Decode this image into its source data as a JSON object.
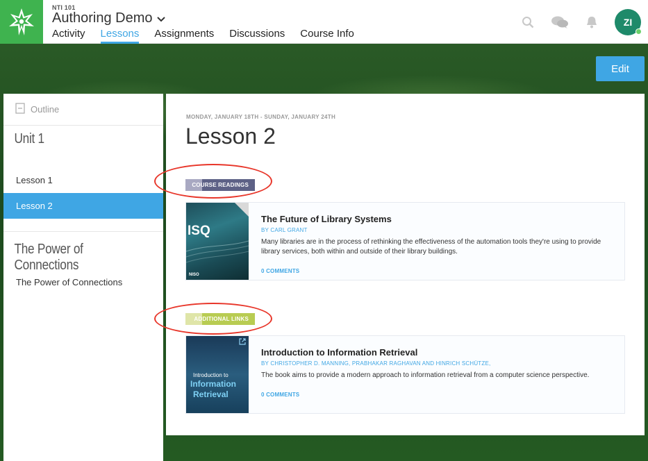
{
  "header": {
    "course_code": "NTI 101",
    "course_title": "Authoring Demo",
    "tabs": [
      {
        "label": "Activity",
        "active": false
      },
      {
        "label": "Lessons",
        "active": true
      },
      {
        "label": "Assignments",
        "active": false
      },
      {
        "label": "Discussions",
        "active": false
      },
      {
        "label": "Course Info",
        "active": false
      }
    ],
    "avatar_initials": "ZI"
  },
  "toolbar": {
    "edit_label": "Edit"
  },
  "sidebar": {
    "outline_label": "Outline",
    "units": [
      {
        "title": "Unit 1",
        "lessons": [
          {
            "label": "Lesson 1",
            "active": false
          },
          {
            "label": "Lesson 2",
            "active": true
          }
        ]
      },
      {
        "title": "The Power of Connections",
        "lessons": [
          {
            "label": "The Power of Connections",
            "active": false
          }
        ]
      }
    ]
  },
  "lesson": {
    "date_range": "MONDAY, JANUARY 18TH - SUNDAY, JANUARY 24TH",
    "title": "Lesson 2",
    "sections": [
      {
        "label": "COURSE READINGS",
        "item": {
          "title": "The Future of Library Systems",
          "author": "BY CARL GRANT",
          "description": "Many libraries are in the process of rethinking the effectiveness of the automation tools they're using to provide library services, both within and outside of their library buildings.",
          "comments": "0 COMMENTS",
          "thumb_text": "ISQ",
          "thumb_footer": "NISO"
        }
      },
      {
        "label": "ADDITIONAL LINKS",
        "item": {
          "title": "Introduction to Information Retrieval",
          "author": "BY CHRISTOPHER D. MANNING, PRABHAKAR RAGHAVAN AND HINRICH SCHÜTZE,",
          "description": "The book aims to provide a modern approach to information retrieval from a computer science perspective.",
          "comments": "0 COMMENTS",
          "thumb_line1": "Introduction to",
          "thumb_line2": "Information",
          "thumb_line3": "Retrieval"
        }
      }
    ]
  },
  "colors": {
    "accent": "#3fa6e4",
    "brand_green": "#3fb34f",
    "readings_label": "#5d6186",
    "links_label": "#b8cc52",
    "annotation_red": "#e8362a"
  },
  "icons": [
    "logo-icon",
    "chevron-down-icon",
    "search-icon",
    "chat-icon",
    "bell-icon",
    "outline-icon",
    "external-link-icon"
  ]
}
